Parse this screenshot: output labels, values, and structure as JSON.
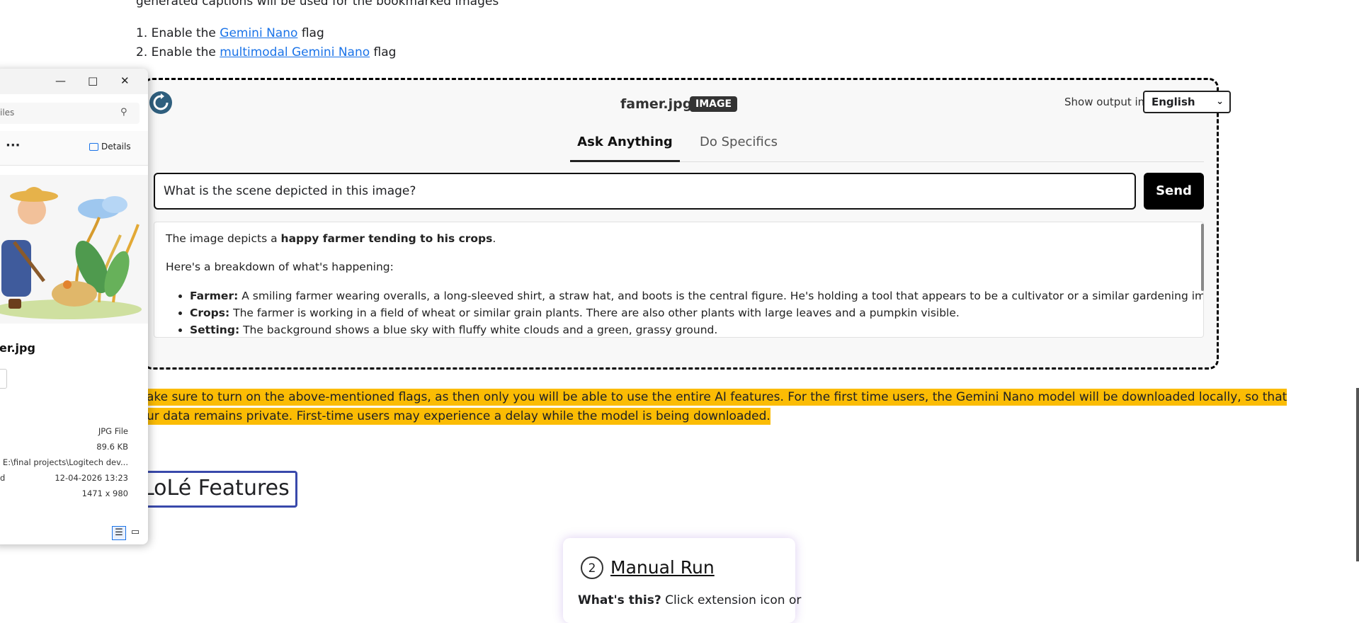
{
  "intro": {
    "text": "generated captions will be used for the bookmarked images",
    "steps": [
      {
        "num": "1.",
        "prefix": "Enable the",
        "link": "Gemini Nano",
        "suffix": "flag"
      },
      {
        "num": "2.",
        "prefix": "Enable the",
        "link": "multimodal Gemini Nano",
        "suffix": "flag"
      }
    ]
  },
  "demo": {
    "filename": "famer.jpg",
    "badge": "IMAGE",
    "show_output_label": "Show output in:",
    "language": "English",
    "tabs": [
      "Ask Anything",
      "Do Specifics"
    ],
    "question": "What is the scene depicted in this image?",
    "send_label": "Send",
    "answer": {
      "intro_prefix": "The image depicts a",
      "intro_bold": "happy farmer tending to his crops",
      "intro_suffix": ".",
      "breakdown": "Here's a breakdown of what's happening:",
      "items": [
        {
          "term": "Farmer:",
          "text": "A smiling farmer wearing overalls, a long-sleeved shirt, a straw hat, and boots is the central figure. He's holding a tool that appears to be a cultivator or a similar gardening implement."
        },
        {
          "term": "Crops:",
          "text": "The farmer is working in a field of wheat or similar grain plants. There are also other plants with large leaves and a pumpkin visible."
        },
        {
          "term": "Setting:",
          "text": "The background shows a blue sky with fluffy white clouds and a green, grassy ground."
        }
      ]
    }
  },
  "highlight": {
    "line1": "ake sure to turn on the above-mentioned flags, as then only you will be able to use the entire AI features. For the first time users, the Gemini Nano model will be downloaded locally, so that",
    "line2": "ur data remains private. First-time users may experience a delay while the model is being downloaded."
  },
  "features_heading": "LoLé Features",
  "card": {
    "number": "2",
    "title": "Manual Run",
    "text_bold": "What's this?",
    "text": "Click extension icon or"
  },
  "explorer": {
    "search_placeholder": "iles",
    "details_label": "Details",
    "more_label": "···",
    "file_name": "er.jpg",
    "meta": {
      "type": "JPG File",
      "size": "89.6 KB",
      "path": "E:\\final projects\\Logitech dev...",
      "date_label": "d",
      "date": "12-04-2026 13:23",
      "dimensions": "1471 x 980"
    }
  },
  "colors": {
    "highlight": "#fbbc04",
    "link": "#1a73e8",
    "heading_border": "#3949ab"
  }
}
